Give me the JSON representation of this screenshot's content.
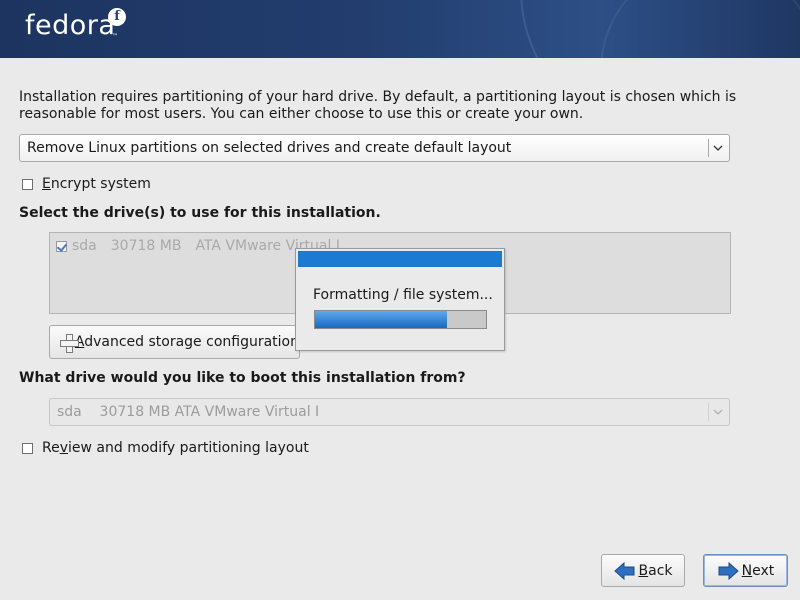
{
  "header": {
    "logo_text": "fedora",
    "logo_mark": "f",
    "logo_tm": "™"
  },
  "intro": {
    "text": "Installation requires partitioning of your hard drive.  By default, a partitioning layout is chosen which is reasonable for most users.  You can either choose to use this or create your own."
  },
  "layout_select": {
    "selected": "Remove Linux partitions on selected drives and create default layout"
  },
  "encrypt": {
    "label_accel": "E",
    "label_rest": "ncrypt system",
    "checked": false
  },
  "drives": {
    "title": "Select the drive(s) to use for this installation.",
    "rows": [
      {
        "checked": true,
        "name": "sda",
        "size": "30718 MB",
        "model": "ATA VMware Virtual I"
      }
    ]
  },
  "advanced_button": {
    "label_accel": "A",
    "label_rest": "dvanced storage configuration"
  },
  "boot": {
    "title": "What drive would you like to boot this installation from?",
    "selected": "sda    30718 MB ATA VMware Virtual I"
  },
  "review": {
    "label_pre": "Re",
    "label_accel": "v",
    "label_rest": "iew and modify partitioning layout",
    "checked": false
  },
  "progress": {
    "message": "Formatting / file system...",
    "fraction": 0.77
  },
  "buttons": {
    "back_accel": "B",
    "back_rest": "ack",
    "next_accel": "N",
    "next_rest": "ext"
  },
  "colors": {
    "header_bg": "#223d6e",
    "progress_fill": "#1769c2",
    "dialog_title": "#1a7bd0",
    "arrow_blue": "#2f6fc0"
  },
  "icons": {
    "combo_arrow": "chevron-down-icon",
    "advanced": "plus-icon",
    "back": "arrow-left-icon",
    "next": "arrow-right-icon"
  }
}
